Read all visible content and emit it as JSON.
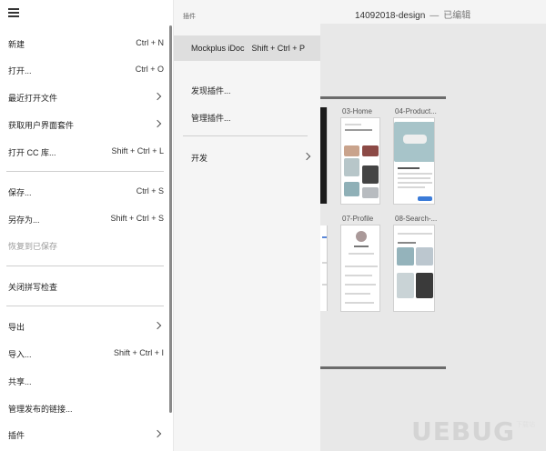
{
  "titlebar": {
    "document_name": "14092018-design",
    "separator": "—",
    "status": "已编辑"
  },
  "main_menu": {
    "items": [
      {
        "label": "新建",
        "shortcut": "Ctrl + N"
      },
      {
        "label": "打开...",
        "shortcut": "Ctrl + O"
      },
      {
        "label": "最近打开文件",
        "shortcut": ""
      },
      {
        "label": "获取用户界面套件",
        "shortcut": ""
      },
      {
        "label": "打开 CC 库...",
        "shortcut": "Shift + Ctrl + L"
      },
      {
        "label": "保存...",
        "shortcut": "Ctrl + S"
      },
      {
        "label": "另存为...",
        "shortcut": "Shift + Ctrl + S"
      },
      {
        "label": "恢复到已保存",
        "shortcut": ""
      },
      {
        "label": "关闭拼写检查",
        "shortcut": ""
      },
      {
        "label": "导出",
        "shortcut": ""
      },
      {
        "label": "导入...",
        "shortcut": "Shift + Ctrl + I"
      },
      {
        "label": "共享...",
        "shortcut": ""
      },
      {
        "label": "管理发布的链接...",
        "shortcut": ""
      },
      {
        "label": "插件",
        "shortcut": ""
      }
    ]
  },
  "submenu": {
    "title": "插件",
    "items": [
      {
        "label": "Mockplus iDoc",
        "shortcut": "Shift + Ctrl + P"
      },
      {
        "label": "发现插件...",
        "shortcut": ""
      },
      {
        "label": "管理插件...",
        "shortcut": ""
      },
      {
        "label": "开发",
        "shortcut": ""
      }
    ]
  },
  "artboards": [
    {
      "label": "03-Home"
    },
    {
      "label": "04-Product..."
    },
    {
      "label": "07-Profile"
    },
    {
      "label": "08-Search-..."
    }
  ],
  "watermark": {
    "text": "UEBUG",
    "subtext": "下载站"
  },
  "icons": {
    "menu": "hamburger-icon",
    "submenu_arrow": "chevron-right-icon"
  },
  "colors": {
    "menu_bg": "#ffffff",
    "submenu_bg": "#f5f5f5",
    "highlight": "#dedede",
    "canvas": "#e8e8e8"
  }
}
